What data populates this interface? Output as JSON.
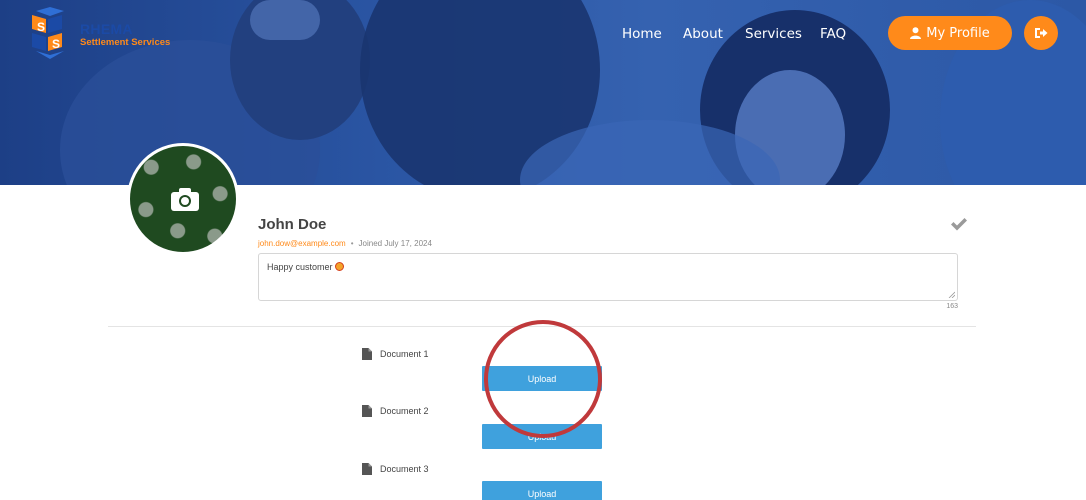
{
  "brand": {
    "title": "RHEMA",
    "subtitle": "Settlement Services"
  },
  "nav": {
    "items": [
      "Home",
      "About",
      "Services",
      "FAQ"
    ],
    "profile_label": "My Profile",
    "profile_icon": "user-icon",
    "logout_icon": "logout-icon"
  },
  "profile": {
    "name": "John Doe",
    "email": "john.dow@example.com",
    "separator": "•",
    "joined": "Joined July 17, 2024",
    "bio": "Happy customer",
    "char_count": "163"
  },
  "documents": [
    {
      "label": "Document 1",
      "button": "Upload"
    },
    {
      "label": "Document 2",
      "button": "Upload"
    },
    {
      "label": "Document 3",
      "button": "Upload"
    }
  ],
  "colors": {
    "accent": "#ff8a1a",
    "primary": "#1b4aa6",
    "upload_button": "#3fa1dd",
    "annotation": "#c0393b"
  }
}
